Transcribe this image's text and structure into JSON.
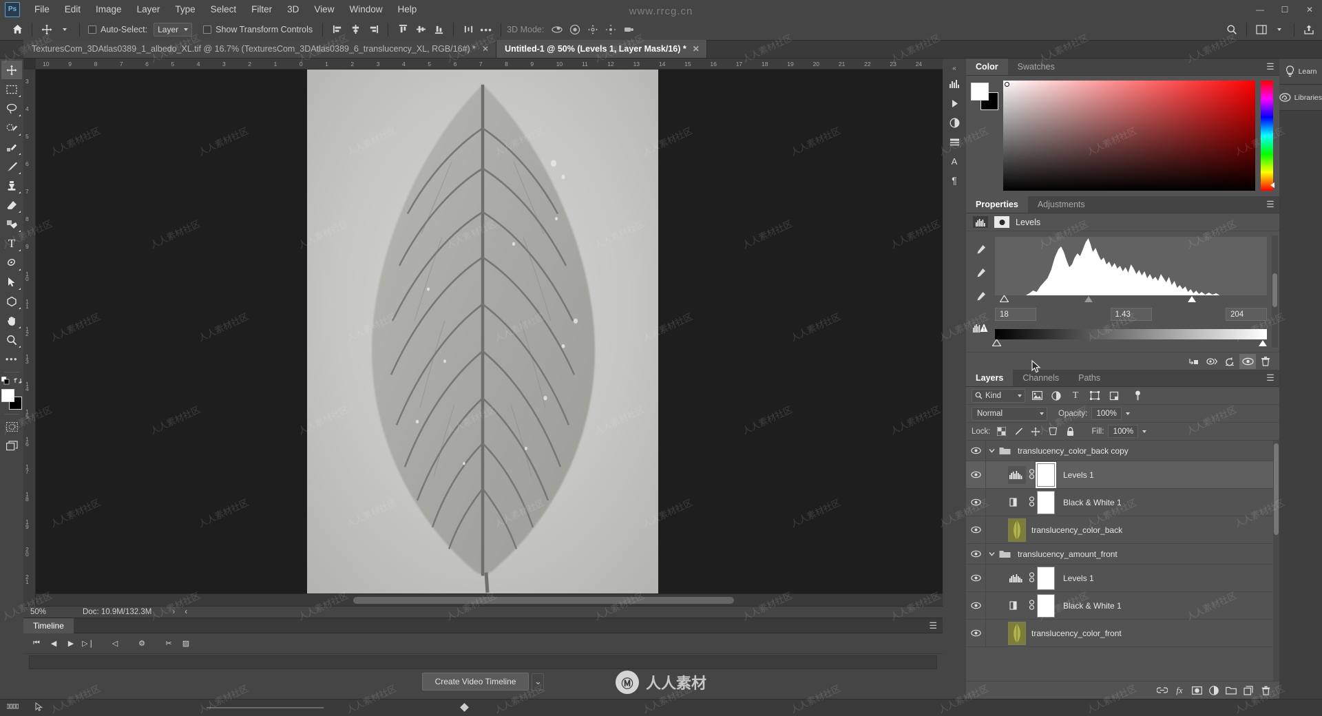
{
  "app": {
    "name": "Adobe Photoshop",
    "logo_text": "Ps"
  },
  "menubar": {
    "items": [
      {
        "label": "File"
      },
      {
        "label": "Edit"
      },
      {
        "label": "Image"
      },
      {
        "label": "Layer"
      },
      {
        "label": "Type"
      },
      {
        "label": "Select"
      },
      {
        "label": "Filter"
      },
      {
        "label": "3D"
      },
      {
        "label": "View"
      },
      {
        "label": "Window"
      },
      {
        "label": "Help"
      }
    ],
    "window_buttons": [
      {
        "name": "minimize",
        "glyph": "—"
      },
      {
        "name": "maximize",
        "glyph": "☐"
      },
      {
        "name": "close",
        "glyph": "✕"
      }
    ]
  },
  "options_bar": {
    "home_icon": "home-icon",
    "tool_icon": "move-tool-icon",
    "auto_select_label": "Auto-Select:",
    "auto_select_checked": false,
    "auto_select_scope": "Layer",
    "show_transform_label": "Show Transform Controls",
    "show_transform_checked": false,
    "align_icons": [
      "align-left-edges-icon",
      "align-horizontal-centers-icon",
      "align-right-edges-icon",
      "align-top-edges-icon",
      "align-vertical-centers-icon",
      "align-bottom-edges-icon"
    ],
    "distribute_icons": [
      "distribute-top-icon",
      "distribute-vertical-center-icon",
      "distribute-bottom-icon",
      "distribute-left-icon"
    ],
    "more_label": "•••",
    "three_d_mode_label": "3D Mode:",
    "three_d_icons": [
      "orbit-3d-icon",
      "roll-3d-icon",
      "pan-3d-icon",
      "slide-3d-icon",
      "scale-3d-icon"
    ],
    "right_icons": [
      "search-icon",
      "workspace-icon",
      "share-icon"
    ]
  },
  "tabs": [
    {
      "label": "TexturesCom_3DAtlas0389_1_albedo_XL.tif @ 16.7% (TexturesCom_3DAtlas0389_6_translucency_XL, RGB/16#) *",
      "active": false,
      "close": "✕"
    },
    {
      "label": "Untitled-1 @ 50% (Levels 1, Layer Mask/16) *",
      "active": true,
      "close": "✕"
    }
  ],
  "toolbar": {
    "tools": [
      {
        "name": "move-tool",
        "glyph": "✥",
        "selected": true
      },
      {
        "name": "rectangular-marquee-tool",
        "glyph": "⬚",
        "selected": false
      },
      {
        "name": "lasso-tool",
        "glyph": "⚲",
        "selected": false
      },
      {
        "name": "quick-selection-tool",
        "glyph": "✒",
        "selected": false
      },
      {
        "name": "crop-tool",
        "glyph": "✄",
        "selected": false
      },
      {
        "name": "eyedropper-tool",
        "glyph": "✐",
        "selected": false
      },
      {
        "name": "spot-healing-brush-tool",
        "glyph": "☂",
        "selected": false
      },
      {
        "name": "brush-tool",
        "glyph": "✎",
        "selected": false
      },
      {
        "name": "clone-stamp-tool",
        "glyph": "⚑",
        "selected": false
      },
      {
        "name": "eraser-tool",
        "glyph": "▱",
        "selected": false
      },
      {
        "name": "gradient-tool",
        "glyph": "◧",
        "selected": false
      },
      {
        "name": "type-tool",
        "glyph": "T",
        "selected": false
      },
      {
        "name": "pen-tool",
        "glyph": "✒",
        "selected": false
      },
      {
        "name": "path-selection-tool",
        "glyph": "➤",
        "selected": false
      },
      {
        "name": "shape-tool",
        "glyph": "⬢",
        "selected": false
      },
      {
        "name": "hand-tool",
        "glyph": "✋",
        "selected": false
      },
      {
        "name": "zoom-tool",
        "glyph": "⚲",
        "selected": false
      },
      {
        "name": "edit-toolbar",
        "glyph": "•••",
        "selected": false
      }
    ],
    "fg_color": "#ffffff",
    "bg_color": "#000000",
    "quick_mask_icon": "quick-mask-icon",
    "screen_mode_icon": "screen-mode-icon"
  },
  "canvas": {
    "ruler_h_ticks": [
      "10",
      "9",
      "8",
      "7",
      "6",
      "5",
      "4",
      "3",
      "2",
      "1",
      "0",
      "1",
      "2",
      "3",
      "4",
      "5",
      "6",
      "7",
      "8",
      "9",
      "10",
      "11",
      "12",
      "13",
      "14",
      "15",
      "16",
      "17",
      "18",
      "19",
      "20",
      "21",
      "22",
      "23",
      "24"
    ],
    "ruler_v_ticks": [
      "3",
      "4",
      "5",
      "6",
      "7",
      "8",
      "9",
      "1 0",
      "1 1",
      "1 2",
      "1 3",
      "1 4",
      "1 5",
      "1 6",
      "1 7",
      "1 8",
      "1 9",
      "2 0",
      "2 1"
    ],
    "doc_description": "grayscale leaf translucency texture"
  },
  "statusbar": {
    "zoom": "50%",
    "doc_info": "Doc: 10.9M/132.3M",
    "arrow_right": "›",
    "arrow_left": "‹"
  },
  "timeline": {
    "tab_label": "Timeline",
    "menu_icon": "panel-menu-icon",
    "controls": [
      {
        "name": "go-to-first-frame",
        "glyph": "⏮"
      },
      {
        "name": "previous-frame",
        "glyph": "◀"
      },
      {
        "name": "play",
        "glyph": "▶"
      },
      {
        "name": "next-frame",
        "glyph": "▷❘"
      },
      {
        "name": "audio-mute",
        "glyph": "◁"
      },
      {
        "name": "settings",
        "glyph": "⚙"
      },
      {
        "name": "split-clip",
        "glyph": "✂"
      },
      {
        "name": "transition",
        "glyph": "▨"
      }
    ],
    "create_button": "Create Video Timeline",
    "create_caret": "⌄"
  },
  "minidock": {
    "collapse_glyph": "«",
    "items": [
      {
        "name": "histogram-panel-icon",
        "glyph": "▐▍"
      },
      {
        "name": "actions-panel-icon",
        "glyph": "▶"
      },
      {
        "name": "adjustments-panel-icon",
        "glyph": "◑"
      },
      {
        "name": "styles-panel-icon",
        "glyph": "≡"
      },
      {
        "name": "character-panel-icon",
        "glyph": "A"
      },
      {
        "name": "paragraph-panel-icon",
        "glyph": "¶"
      }
    ]
  },
  "color_panel": {
    "tabs": [
      {
        "label": "Color",
        "active": true
      },
      {
        "label": "Swatches",
        "active": false
      }
    ],
    "menu_icon": "panel-menu-icon",
    "foreground": "#ffffff",
    "background": "#000000",
    "spectrum_base_hue": "#ff0000"
  },
  "properties_panel": {
    "tabs": [
      {
        "label": "Properties",
        "active": true
      },
      {
        "label": "Adjustments",
        "active": false
      }
    ],
    "menu_icon": "panel-menu-icon",
    "adjustment_title": "Levels",
    "adjustment_icon": "levels-histogram-icon",
    "mask_icon": "layer-mask-icon",
    "eyedroppers": [
      {
        "name": "set-black-point-eyedropper",
        "glyph": "✐"
      },
      {
        "name": "set-gray-point-eyedropper",
        "glyph": "✐"
      },
      {
        "name": "set-white-point-eyedropper",
        "glyph": "✐"
      }
    ],
    "auto_icon": "auto-levels-warning-icon",
    "input_shadow": "18",
    "input_midtone": "1.43",
    "input_highlight": "204",
    "footer_buttons": [
      {
        "name": "clip-to-layer-button",
        "glyph": "↳■"
      },
      {
        "name": "view-previous-state-button",
        "glyph": "⧉"
      },
      {
        "name": "reset-button",
        "glyph": "↺"
      },
      {
        "name": "toggle-visibility-button",
        "glyph": "◉",
        "active": true
      },
      {
        "name": "delete-adjustment-button",
        "glyph": "Ὕ1"
      }
    ]
  },
  "layers_panel": {
    "tabs": [
      {
        "label": "Layers",
        "active": true
      },
      {
        "label": "Channels",
        "active": false
      },
      {
        "label": "Paths",
        "active": false
      }
    ],
    "menu_icon": "panel-menu-icon",
    "filter_kind_label": "Kind",
    "filter_search_icon": "search-icon",
    "filter_icons": [
      {
        "name": "filter-pixel-layers-icon",
        "glyph": "⛰"
      },
      {
        "name": "filter-adjustment-layers-icon",
        "glyph": "◑"
      },
      {
        "name": "filter-type-layers-icon",
        "glyph": "T"
      },
      {
        "name": "filter-shape-layers-icon",
        "glyph": "⬚"
      },
      {
        "name": "filter-smart-objects-icon",
        "glyph": "❐"
      }
    ],
    "filter_toggle_icon": "filter-power-toggle-icon",
    "blend_mode": "Normal",
    "opacity_label": "Opacity:",
    "opacity_value": "100%",
    "lock_label": "Lock:",
    "lock_icons": [
      {
        "name": "lock-transparent-pixels-icon",
        "glyph": "▒"
      },
      {
        "name": "lock-image-pixels-icon",
        "glyph": "✎"
      },
      {
        "name": "lock-position-icon",
        "glyph": "✥"
      },
      {
        "name": "lock-artboard-nesting-icon",
        "glyph": "⬚"
      },
      {
        "name": "lock-all-icon",
        "glyph": "🔒"
      }
    ],
    "fill_label": "Fill:",
    "fill_value": "100%",
    "rows": [
      {
        "type": "group",
        "name": "translucency_color_back copy",
        "visible": true,
        "expanded": true,
        "selected": false
      },
      {
        "type": "adjustment",
        "name": "Levels 1",
        "visible": true,
        "selected": true,
        "icon": "levels-histogram-icon",
        "linked": true,
        "mask": true
      },
      {
        "type": "adjustment",
        "name": "Black & White 1",
        "visible": true,
        "selected": false,
        "icon": "black-and-white-icon",
        "linked": true,
        "mask": true
      },
      {
        "type": "pixel",
        "name": "translucency_color_back",
        "visible": true,
        "selected": false
      },
      {
        "type": "group",
        "name": "translucency_amount_front",
        "visible": true,
        "expanded": true,
        "selected": false
      },
      {
        "type": "adjustment",
        "name": "Levels 1",
        "visible": true,
        "selected": false,
        "icon": "levels-histogram-icon",
        "linked": true,
        "mask": true
      },
      {
        "type": "adjustment",
        "name": "Black & White 1",
        "visible": true,
        "selected": false,
        "icon": "black-and-white-icon",
        "linked": true,
        "mask": true
      },
      {
        "type": "pixel",
        "name": "translucency_color_front",
        "visible": true,
        "selected": false
      }
    ],
    "footer_buttons": [
      {
        "name": "link-layers-button",
        "glyph": "⚭"
      },
      {
        "name": "layer-style-button",
        "glyph": "fx"
      },
      {
        "name": "layer-mask-button",
        "glyph": "◱"
      },
      {
        "name": "new-adjustment-layer-button",
        "glyph": "◑"
      },
      {
        "name": "new-group-button",
        "glyph": "🗀"
      },
      {
        "name": "new-layer-button",
        "glyph": "⧉"
      },
      {
        "name": "delete-layer-button",
        "glyph": "🗑"
      }
    ]
  },
  "rail": {
    "items": [
      {
        "label": "Learn",
        "icon": "lightbulb-icon"
      },
      {
        "label": "Libraries",
        "icon": "creative-cloud-libraries-icon"
      }
    ]
  },
  "bottombar": {
    "grid_icon": "grid-icon",
    "pointer_icon": "pointer-icon"
  },
  "watermarks": {
    "top": "www.rrcg.cn",
    "logo_mark": "Ⓜ",
    "logo_text": "人人素材",
    "tile": "人人素材社区"
  },
  "colors": {
    "panel_bg": "#535353",
    "chrome_bg": "#454545",
    "canvas_bg": "#1e1e1e",
    "accent": "#6cb6e8",
    "text": "#dcdcdc"
  }
}
